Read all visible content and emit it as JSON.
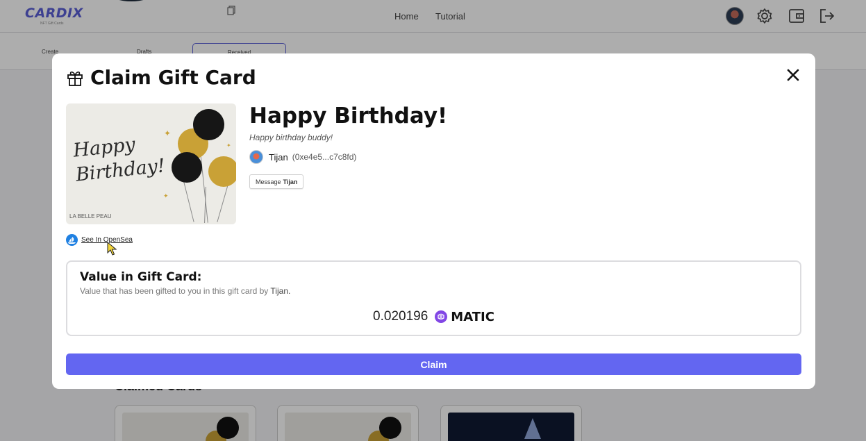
{
  "header": {
    "logo": "CARDIX",
    "logo_sub": "NFT Gift Cards",
    "nav": [
      {
        "label": "Home"
      },
      {
        "label": "Tutorial"
      }
    ]
  },
  "subnav": {
    "tabs": [
      {
        "label": "Create"
      },
      {
        "label": "Drafts"
      },
      {
        "label": "Received"
      }
    ]
  },
  "background": {
    "claimed_heading": "Claimed Cards"
  },
  "modal": {
    "title": "Claim Gift Card",
    "card_image": {
      "script_line1": "Happy",
      "script_line2": "Birthday!",
      "brand": "LA BELLE PEAU"
    },
    "opensea_link": "See In OpenSea",
    "card_title": "Happy Birthday!",
    "card_message": "Happy birthday buddy!",
    "sender": {
      "name": "Tijan",
      "address": "(0xe4e5...c7c8fd)"
    },
    "message_button": {
      "prefix": "Message",
      "name": "Tijan"
    },
    "value": {
      "title": "Value in Gift Card:",
      "desc_prefix": "Value that has been gifted to you in this gift card by",
      "desc_name": "Tijan.",
      "amount": "0.020196",
      "currency": "MATIC"
    },
    "claim_label": "Claim"
  },
  "colors": {
    "accent": "#6366f1",
    "matic": "#8247e5",
    "opensea": "#2081e2",
    "gold": "#c9a136"
  }
}
